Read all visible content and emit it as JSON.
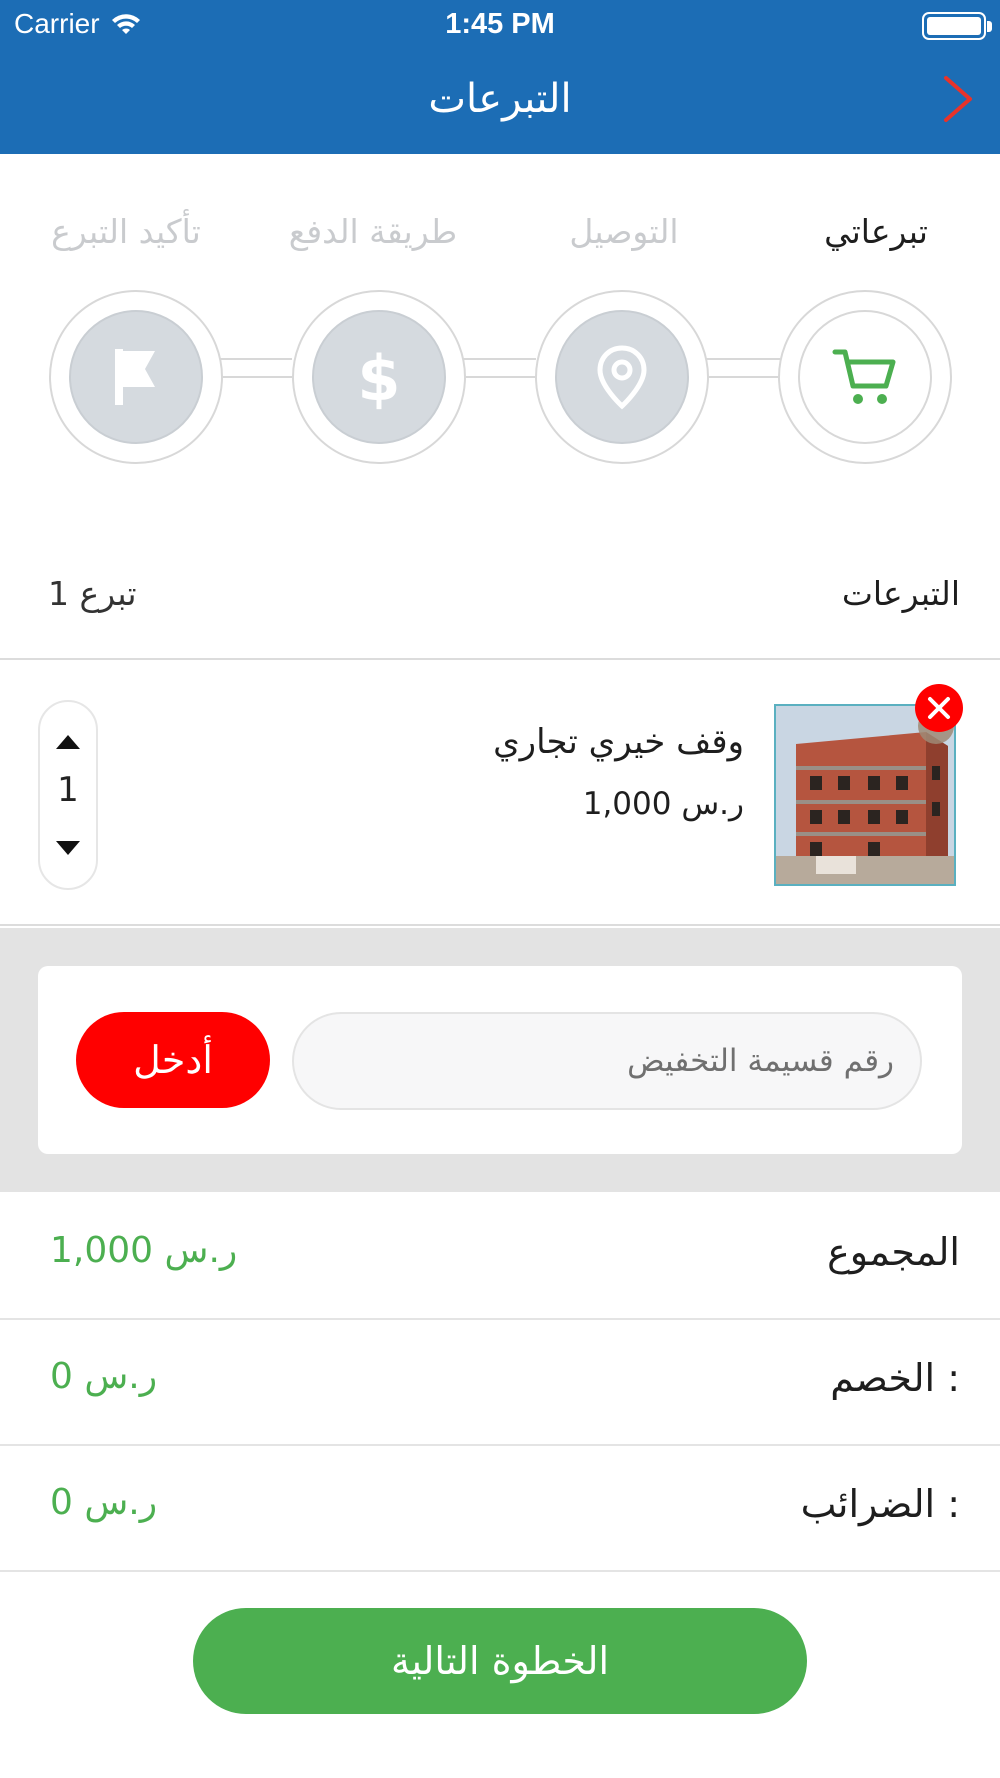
{
  "status_bar": {
    "carrier": "Carrier",
    "time": "1:45 PM"
  },
  "nav": {
    "title": "التبرعات"
  },
  "steps": [
    {
      "label": "تبرعاتي",
      "icon": "cart-icon",
      "active": true
    },
    {
      "label": "التوصيل",
      "icon": "location-pin-icon",
      "active": false
    },
    {
      "label": "طريقة الدفع",
      "icon": "dollar-icon",
      "active": false
    },
    {
      "label": "تأكيد التبرع",
      "icon": "flag-icon",
      "active": false
    }
  ],
  "donations": {
    "title": "التبرعات",
    "count": "1 تبرع"
  },
  "item": {
    "name": "وقف خيري تجاري",
    "price": "1,000 ر.س",
    "quantity": "1",
    "image": "building-photo"
  },
  "coupon": {
    "placeholder": "رقم قسيمة التخفيض",
    "button_label": "أدخل"
  },
  "totals": {
    "subtotal_label": "المجموع",
    "subtotal_value": "1,000 ر.س",
    "discount_label": "الخصم :",
    "discount_value": "0 ر.س",
    "taxes_label": "الضرائب :",
    "taxes_value": "0 ر.س"
  },
  "next_button": "الخطوة التالية",
  "colors": {
    "nav": "#1c6db5",
    "accent_green": "#4caf50",
    "danger_red": "#ff0000",
    "step_inactive": "#d5dadf"
  }
}
